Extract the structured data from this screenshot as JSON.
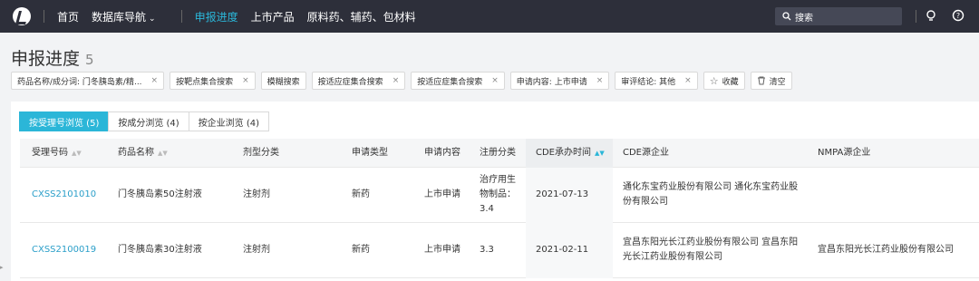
{
  "nav": {
    "items": [
      {
        "label": "首页",
        "active": false
      },
      {
        "label": "数据库导航",
        "active": false,
        "caret": "⌄"
      },
      {
        "label": "申报进度",
        "active": true
      },
      {
        "label": "上市产品",
        "active": false
      },
      {
        "label": "原料药、辅药、包材料",
        "active": false
      }
    ],
    "search_placeholder": "搜索",
    "accent": "#2bb6d8"
  },
  "page": {
    "title": "申报进度",
    "count": "5"
  },
  "filters": [
    {
      "label": "药品名称/成分词: 门冬胰岛素/精...",
      "close": "×"
    },
    {
      "label": "按靶点集合搜索",
      "close": "×"
    },
    {
      "label": "模糊搜索",
      "close": ""
    },
    {
      "label": "按适应症集合搜索",
      "close": "×"
    },
    {
      "label": "按适应症集合搜索",
      "close": "×"
    },
    {
      "label": "申请内容: 上市申请",
      "close": "×"
    },
    {
      "label": "审评结论: 其他",
      "close": "×"
    }
  ],
  "actions": {
    "favorite": "收藏",
    "clear": "清空"
  },
  "tabs": [
    {
      "label": "按受理号浏览 (5)",
      "active": true
    },
    {
      "label": "按成分浏览 (4)",
      "active": false
    },
    {
      "label": "按企业浏览 (4)",
      "active": false
    }
  ],
  "table": {
    "headers": [
      "受理号码",
      "药品名称",
      "剂型分类",
      "申请类型",
      "申请内容",
      "注册分类",
      "CDE承办时间",
      "CDE源企业",
      "NMPA源企业"
    ],
    "rows": [
      {
        "id": "CXSS2101010",
        "name": "门冬胰岛素50注射液",
        "form": "注射剂",
        "type": "新药",
        "content": "上市申请",
        "class_lines": [
          "治疗用生",
          "物制品：",
          "3.4"
        ],
        "date": "2021-07-13",
        "cde_lines": [
          "通化东宝药业股份有限公司 通化东宝药业股",
          "份有限公司"
        ],
        "nmpa": ""
      },
      {
        "id": "CXSS2100019",
        "name": "门冬胰岛素30注射液",
        "form": "注射剂",
        "type": "新药",
        "content": "上市申请",
        "class_lines": [
          "3.3"
        ],
        "date": "2021-02-11",
        "cde_lines": [
          "宜昌东阳光长江药业股份有限公司 宜昌东阳",
          "光长江药业股份有限公司"
        ],
        "nmpa": "宜昌东阳光长江药业股份有限公司"
      }
    ]
  }
}
